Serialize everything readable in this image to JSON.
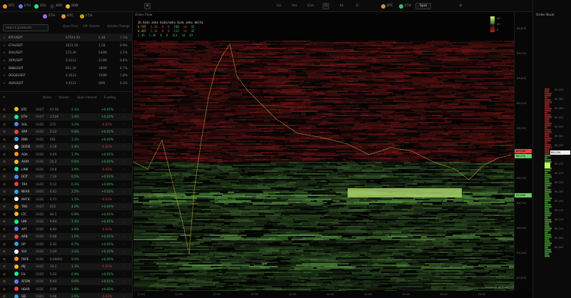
{
  "header": {
    "coins_row1": [
      {
        "label": "BTC",
        "color": "#f7931a"
      },
      {
        "label": "ETH",
        "color": "#627eea"
      },
      {
        "label": "SOL",
        "color": "#14f195"
      },
      {
        "label": "XRP",
        "color": "#23292f"
      },
      {
        "label": "BNB",
        "color": "#f3ba2f"
      }
    ],
    "coins_row2": [
      {
        "label": "ETH",
        "color": "#a06cf0"
      },
      {
        "label": "BTC",
        "color": "#f7931a"
      },
      {
        "label": "ETH",
        "color": "#d4a017"
      }
    ],
    "toolbar": [
      "1m",
      "5m",
      "15m",
      "1h",
      "4h",
      "D"
    ],
    "toolbar_icons": [
      "grid-icon",
      "settings-icon"
    ],
    "right_coins": [
      {
        "label": "BTC",
        "color": "#d49a2a"
      },
      {
        "label": "ETH",
        "color": "#3fbf6f"
      }
    ],
    "right_button": "Spot",
    "top_right_action": "Open in Pro"
  },
  "left": {
    "search_placeholder": "Search products",
    "columns": [
      "Symbol",
      "Open Price",
      "24h Volume",
      "Volume Change"
    ],
    "products": [
      {
        "sym": "BTCUSDT",
        "price": "67524.00",
        "vol": "2.4B",
        "chg": "1.1%"
      },
      {
        "sym": "ETHUSDT",
        "price": "3521.50",
        "vol": "1.2B",
        "chg": "0.9%"
      },
      {
        "sym": "SOLUSDT",
        "price": "172.30",
        "vol": "540M",
        "chg": "2.1%"
      },
      {
        "sym": "XRPUSDT",
        "price": "0.5212",
        "vol": "210M",
        "chg": "0.4%"
      },
      {
        "sym": "BNBUSDT",
        "price": "601.20",
        "vol": "180M",
        "chg": "0.7%"
      },
      {
        "sym": "DOGEUSDT",
        "price": "0.1623",
        "vol": "150M",
        "chg": "1.8%"
      },
      {
        "sym": "ADAUSDT",
        "price": "0.4521",
        "vol": "96M",
        "chg": "0.3%"
      }
    ],
    "watch_columns": [
      "#",
      "Name",
      "Volume",
      "Open Interest",
      "Funding"
    ],
    "watch": [
      {
        "n": "BTC",
        "a": "USDT",
        "p": "67.5K",
        "v": "2.1%",
        "f": "+0.01%"
      },
      {
        "n": "ETH",
        "a": "USDT",
        "p": "3.52K",
        "v": "1.4%",
        "f": "+0.02%"
      },
      {
        "n": "SOL",
        "a": "USDC",
        "p": "172",
        "v": "3.2%",
        "f": "-0.01%"
      },
      {
        "n": "XRP",
        "a": "USDC",
        "p": "0.52",
        "v": "0.8%",
        "f": "+0.01%"
      },
      {
        "n": "BNB",
        "a": "USDC",
        "p": "601",
        "v": "1.1%",
        "f": "+0.03%"
      },
      {
        "n": "DOGE",
        "a": "USDC",
        "p": "0.16",
        "v": "2.4%",
        "f": "-0.02%"
      },
      {
        "n": "ADA",
        "a": "USDC",
        "p": "0.45",
        "v": "1.7%",
        "f": "+0.01%"
      },
      {
        "n": "AVAX",
        "a": "USDC",
        "p": "35.2",
        "v": "0.6%",
        "f": "+0.02%"
      },
      {
        "n": "LINK",
        "a": "USDC",
        "p": "14.8",
        "v": "1.9%",
        "f": "-0.01%"
      },
      {
        "n": "DOT",
        "a": "USDC",
        "p": "7.10",
        "v": "0.5%",
        "f": "+0.01%"
      },
      {
        "n": "TRX",
        "a": "USDC",
        "p": "0.12",
        "v": "0.3%",
        "f": "+0.00%"
      },
      {
        "n": "NEAR",
        "a": "USDC",
        "p": "6.42",
        "v": "2.2%",
        "f": "+0.02%"
      },
      {
        "n": "MATIC",
        "a": "USDC",
        "p": "0.71",
        "v": "1.5%",
        "f": "-0.01%"
      },
      {
        "n": "TAO",
        "a": "USDT",
        "p": "412",
        "v": "4.0%",
        "f": "+0.04%"
      },
      {
        "n": "LTC",
        "a": "USDC",
        "p": "84.1",
        "v": "0.9%",
        "f": "+0.01%"
      },
      {
        "n": "UNI",
        "a": "USDC",
        "p": "9.84",
        "v": "1.3%",
        "f": "+0.01%"
      },
      {
        "n": "APT",
        "a": "USDC",
        "p": "8.92",
        "v": "2.6%",
        "f": "-0.02%"
      },
      {
        "n": "ARB",
        "a": "USDC",
        "p": "0.98",
        "v": "1.0%",
        "f": "+0.01%"
      },
      {
        "n": "OP",
        "a": "USDC",
        "p": "2.31",
        "v": "0.7%",
        "f": "+0.01%"
      },
      {
        "n": "SUI",
        "a": "USDC",
        "p": "1.04",
        "v": "3.1%",
        "f": "+0.03%"
      },
      {
        "n": "PEPE",
        "a": "USDC",
        "p": "0.00001",
        "v": "5.0%",
        "f": "+0.05%"
      },
      {
        "n": "INJ",
        "a": "USDC",
        "p": "24.1",
        "v": "1.2%",
        "f": "-0.01%"
      },
      {
        "n": "FIL",
        "a": "USDC",
        "p": "5.62",
        "v": "0.9%",
        "f": "+0.01%"
      },
      {
        "n": "ATOM",
        "a": "USDC",
        "p": "8.44",
        "v": "0.6%",
        "f": "+0.01%"
      },
      {
        "n": "HBAR",
        "a": "USDC",
        "p": "0.09",
        "v": "1.8%",
        "f": "+0.02%"
      },
      {
        "n": "SEI",
        "a": "USDC",
        "p": "0.48",
        "v": "2.9%",
        "f": "-0.03%"
      }
    ]
  },
  "chart": {
    "title": "Order Flow",
    "stats_header": "1h  bids  asks  bids/asks  bids  asks  delta",
    "stats_rows": [
      [
        "0.59T",
        "1.36",
        "0",
        "0",
        "100",
        "+0",
        "43"
      ],
      [
        "0.46T",
        "1.36",
        "0",
        "0",
        "113",
        "+0",
        "42"
      ],
      [
        "1.36",
        "1.36",
        "0",
        "0",
        "113",
        "+0",
        "43"
      ]
    ],
    "price_labels": [
      "66,800",
      "66,700",
      "66,600",
      "66,500",
      "66,400",
      "66,300",
      "66,200",
      "66,100",
      "66,000",
      "65,900",
      "65,800"
    ],
    "price_tag_red": "66,280",
    "price_tag_green": "66,250",
    "price_tag_low": "65,980",
    "time_labels": [
      "12:00",
      "12:30",
      "13:00",
      "13:30",
      "14:00",
      "14:30",
      "15:00",
      "15:30",
      "16:00",
      "16:30"
    ],
    "legend": [
      "40",
      "20",
      "0"
    ],
    "footer": "powered by Flow"
  },
  "orderbook": {
    "title": "Order Book",
    "levels": [
      "66,400",
      "66,380",
      "66,360",
      "66,340",
      "66,320",
      "66,300",
      "66,280",
      "66,260",
      "66,240",
      "66,220",
      "66,200",
      "66,180",
      "66,160",
      "66,140",
      "66,120",
      "66,100",
      "66,080",
      "66,060"
    ],
    "spread": "66,250"
  }
}
